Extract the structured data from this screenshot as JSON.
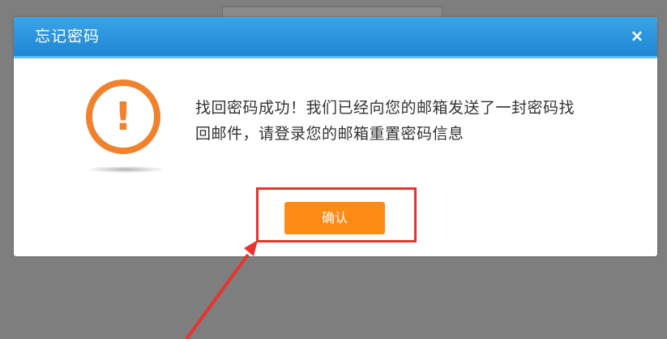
{
  "dialog": {
    "title": "忘记密码",
    "close_glyph": "×",
    "icon": "exclamation-circle-icon",
    "icon_glyph": "!",
    "message": "找回密码成功！我们已经向您的邮箱发送了一封密码找回邮件，请登录您的邮箱重置密码信息",
    "confirm_label": "确认"
  },
  "colors": {
    "header_blue": "#1f86d4",
    "accent_orange": "#ff8a14",
    "annotation_red": "#e8332f",
    "overlay_gray": "#7e7e7e"
  }
}
